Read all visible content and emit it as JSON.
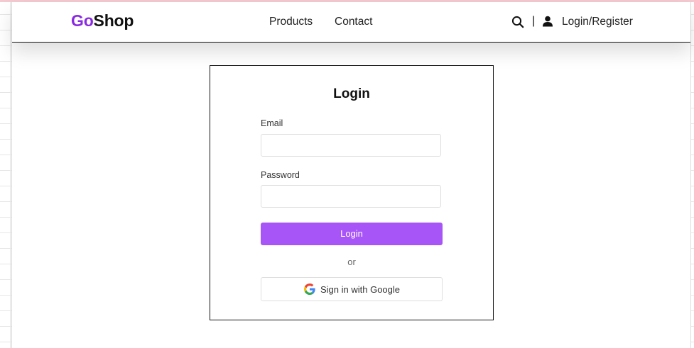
{
  "brand": {
    "logo_part1": "Go",
    "logo_part2": "Shop",
    "accent_color": "#8a2be2",
    "button_color": "#a855f7"
  },
  "nav": {
    "links": [
      {
        "label": "Products"
      },
      {
        "label": "Contact"
      }
    ],
    "search_icon": "search-icon",
    "divider": "|",
    "user_icon": "user-icon",
    "login_register": "Login/Register"
  },
  "login_form": {
    "title": "Login",
    "email_label": "Email",
    "email_value": "",
    "password_label": "Password",
    "password_value": "",
    "submit_label": "Login",
    "or_text": "or",
    "google_icon": "google-icon",
    "google_label": "Sign in with Google"
  }
}
